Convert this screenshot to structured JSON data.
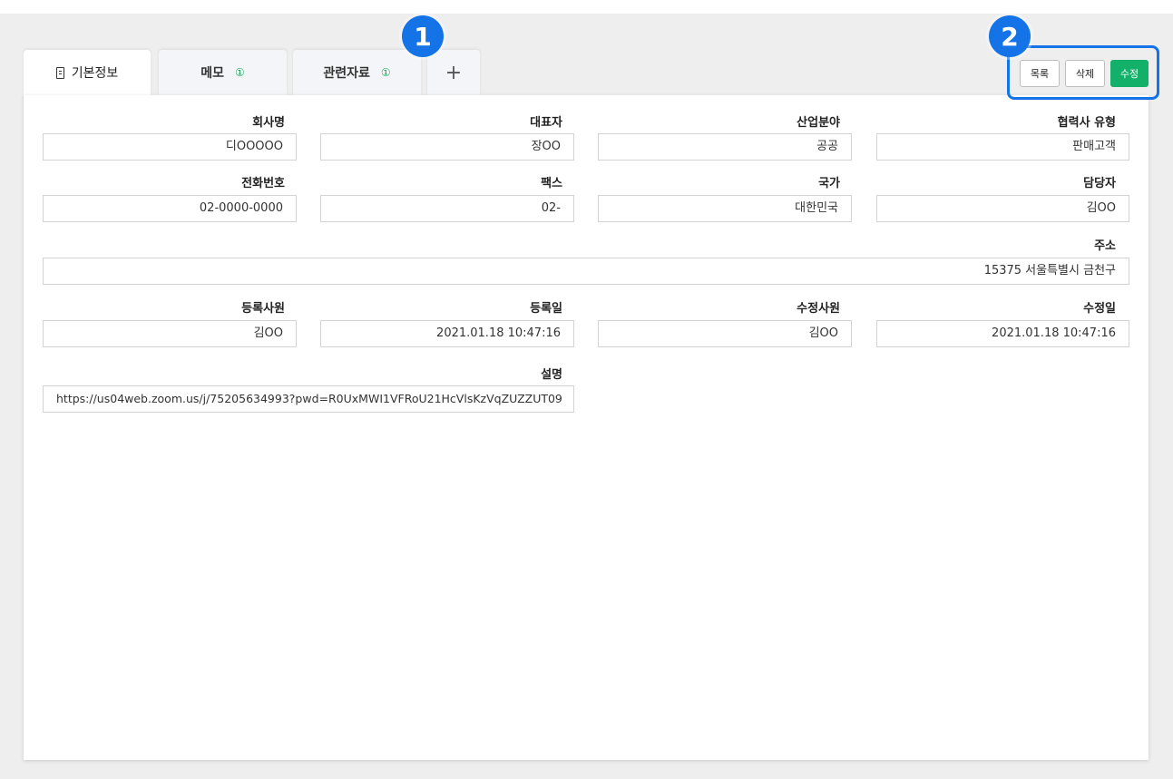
{
  "tabs": [
    {
      "label": "기본정보",
      "count": ""
    },
    {
      "label": "메모",
      "count": "①"
    },
    {
      "label": "관련자료",
      "count": "①"
    }
  ],
  "add_tab_label": "+",
  "actions": {
    "list": "목록",
    "delete": "삭제",
    "edit": "수정"
  },
  "badges": {
    "one": "1",
    "two": "2"
  },
  "fields": {
    "company": {
      "label": "회사명",
      "value": "디OOOOO"
    },
    "ceo": {
      "label": "대표자",
      "value": "장OO"
    },
    "industry": {
      "label": "산업분야",
      "value": "공공"
    },
    "partner_type": {
      "label": "협력사 유형",
      "value": "판매고객"
    },
    "phone": {
      "label": "전화번호",
      "value": "02-0000-0000"
    },
    "fax": {
      "label": "팩스",
      "value": "02-"
    },
    "country": {
      "label": "국가",
      "value": "대한민국"
    },
    "manager": {
      "label": "담당자",
      "value": "김OO"
    },
    "address": {
      "label": "주소",
      "value": "15375 서울특별시 금천구"
    },
    "registrar": {
      "label": "등록사원",
      "value": "김OO"
    },
    "reg_date": {
      "label": "등록일",
      "value": "2021.01.18  10:47:16"
    },
    "editor": {
      "label": "수정사원",
      "value": "김OO"
    },
    "edit_date": {
      "label": "수정일",
      "value": "2021.01.18  10:47:16"
    },
    "description": {
      "label": "설명",
      "value": "https://us04web.zoom.us/j/75205634993?pwd=R0UxMWI1VFRoU21HcVlsKzVqZUZZUT09"
    }
  }
}
